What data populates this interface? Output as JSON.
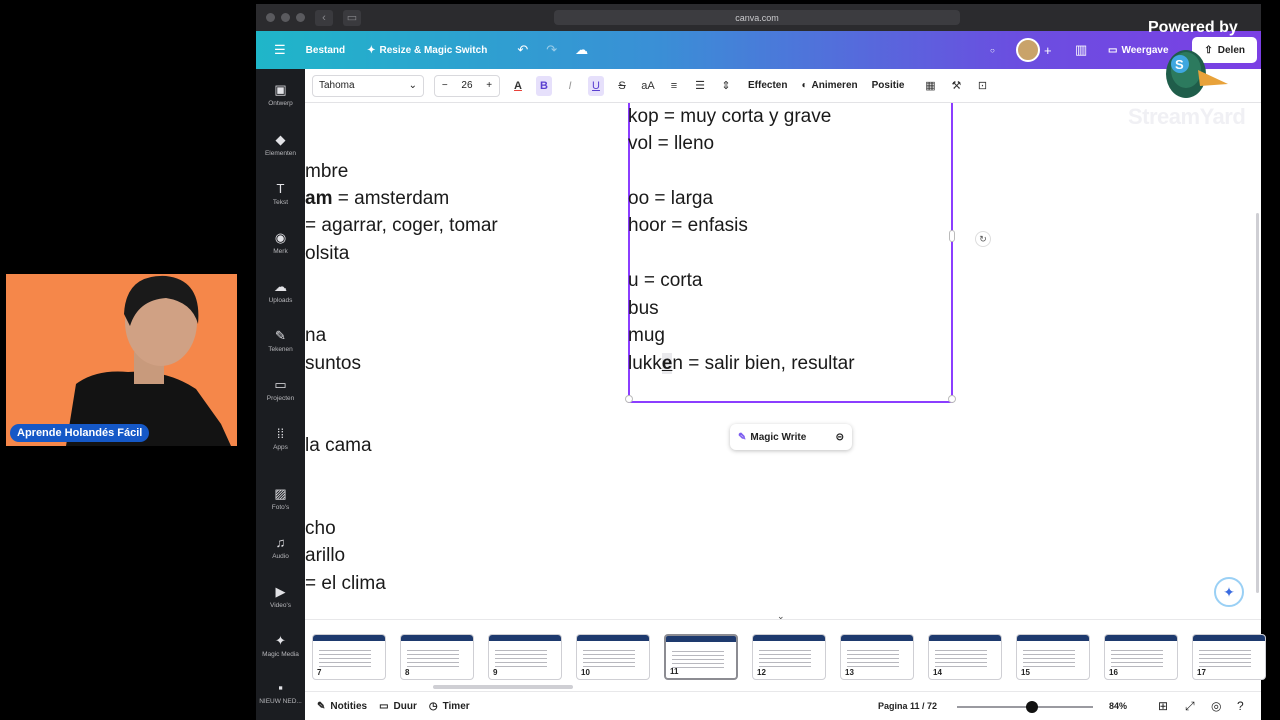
{
  "browser": {
    "url": "canva.com"
  },
  "topbar": {
    "menu_icon": "hamburger-icon",
    "file_label": "Bestand",
    "resize_label": "Resize & Magic Switch",
    "view_label": "Weergave",
    "share_label": "Delen"
  },
  "sidebar": {
    "items": [
      {
        "label": "Ontwerp",
        "icon": "▣"
      },
      {
        "label": "Elementen",
        "icon": "◆"
      },
      {
        "label": "Tekst",
        "icon": "T"
      },
      {
        "label": "Merk",
        "icon": "◉"
      },
      {
        "label": "Uploads",
        "icon": "☁"
      },
      {
        "label": "Tekenen",
        "icon": "✎"
      },
      {
        "label": "Projecten",
        "icon": "▭"
      },
      {
        "label": "Apps",
        "icon": "⁞⁞"
      },
      {
        "label": "Foto's",
        "icon": "▨"
      },
      {
        "label": "Audio",
        "icon": "♫"
      },
      {
        "label": "Video's",
        "icon": "▶"
      },
      {
        "label": "Magic Media",
        "icon": "✦"
      },
      {
        "label": "NIEUW NED...",
        "icon": "▪"
      }
    ]
  },
  "toolbar": {
    "font": "Tahoma",
    "size": "26",
    "effects_label": "Effecten",
    "animate_label": "Animeren",
    "position_label": "Positie"
  },
  "page": {
    "left_lines": [
      "mbre",
      "am",
      " = amsterdam",
      "= agarrar, coger, tomar",
      "olsita",
      "na",
      "suntos",
      "la cama",
      "cho",
      "arillo",
      "= el clima"
    ],
    "right_lines": [
      "kop = muy corta y grave",
      "vol = lleno",
      "oo = larga",
      "hoor = enfasis",
      "u = corta",
      "bus",
      "mug",
      "lukk",
      "e",
      "n = salir bien, resultar"
    ],
    "magic_write_label": "Magic Write"
  },
  "thumbnails": [
    "7",
    "8",
    "9",
    "10",
    "11",
    "12",
    "13",
    "14",
    "15",
    "16",
    "17"
  ],
  "bottombar": {
    "notes_label": "Notities",
    "duration_label": "Duur",
    "timer_label": "Timer",
    "page_indicator": "Pagina 11 / 72",
    "zoom": "84%",
    "zoom_fraction": 0.55
  },
  "webcam": {
    "name": "Aprende Holandés Fácil"
  },
  "overlay": {
    "powered": "Powered by",
    "brand": "StreamYard"
  }
}
